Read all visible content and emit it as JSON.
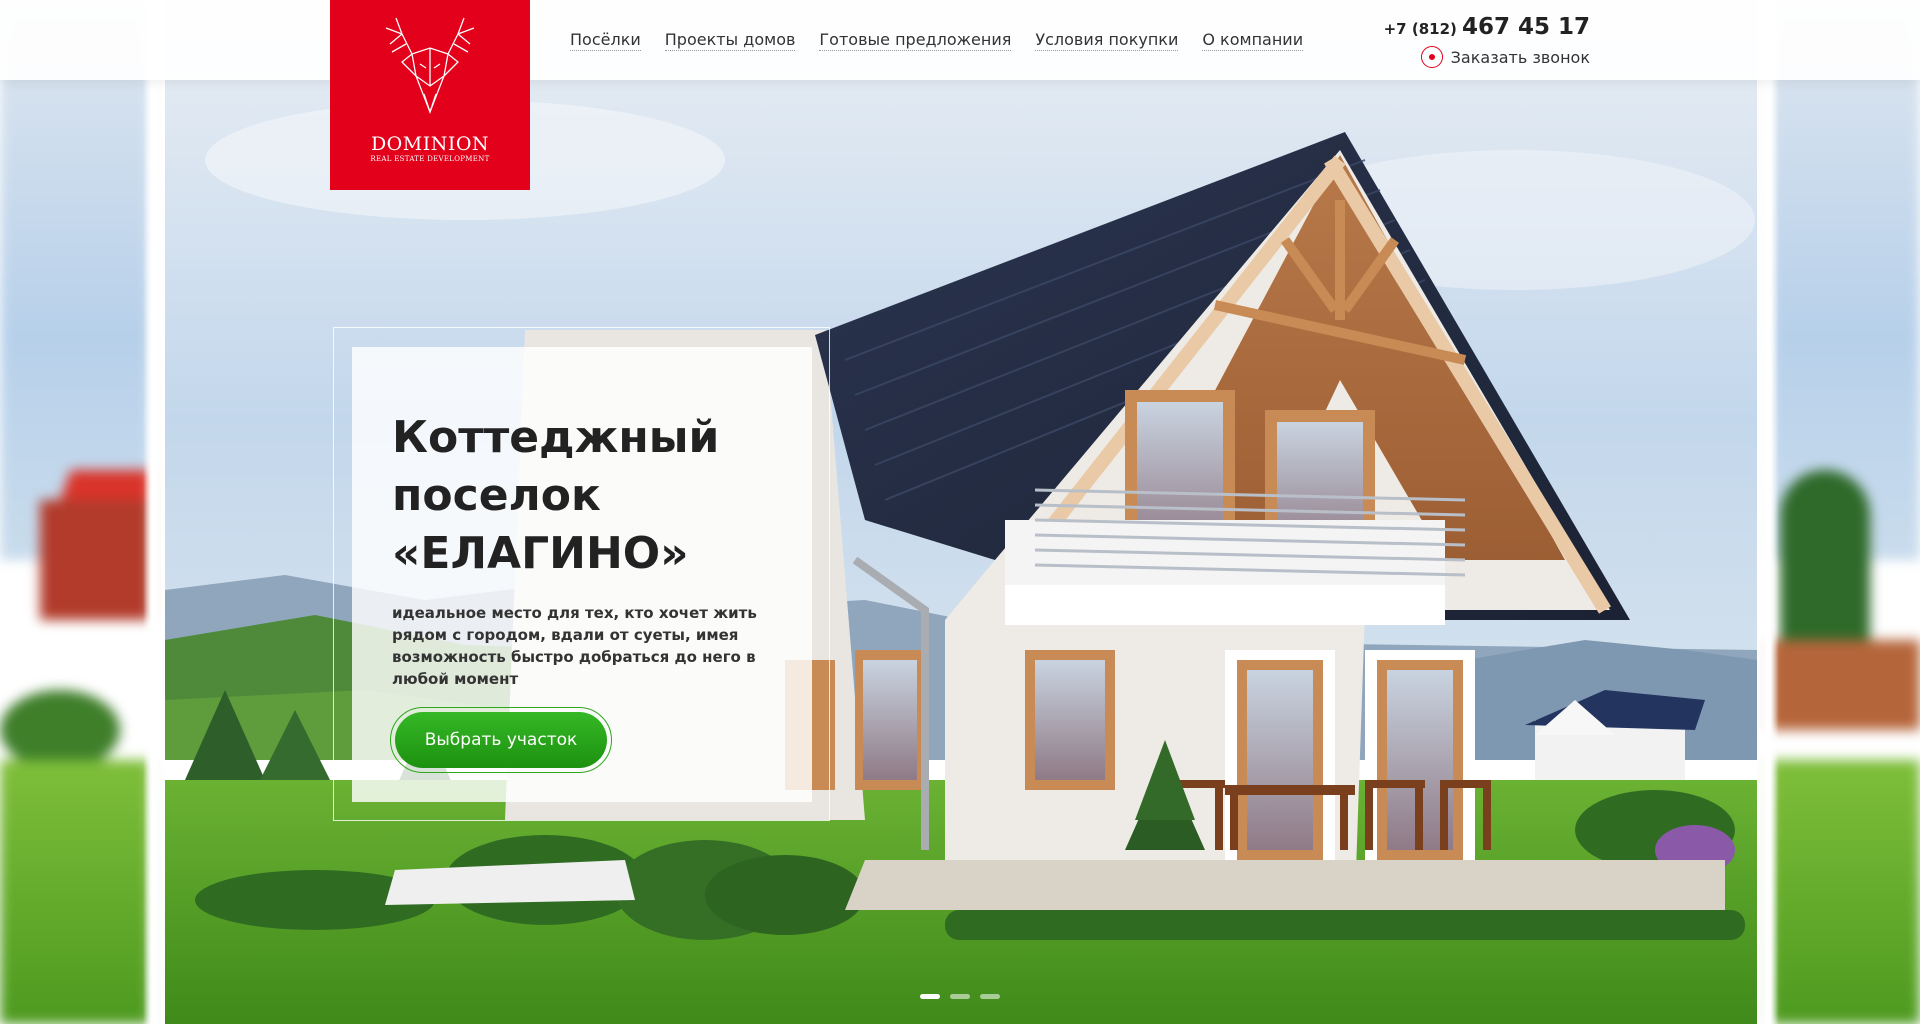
{
  "brand": {
    "name": "DOMINION",
    "tagline": "REAL ESTATE DEVELOPMENT",
    "color": "#e2001a",
    "icon": "deer-head-icon"
  },
  "nav": {
    "items": [
      {
        "label": "Посёлки"
      },
      {
        "label": "Проекты домов"
      },
      {
        "label": "Готовые предложения"
      },
      {
        "label": "Условия покупки"
      },
      {
        "label": "О компании"
      }
    ]
  },
  "contact": {
    "phone_prefix": "+7 (812)",
    "phone_number": "467 45 17",
    "callback_label": "Заказать звонок",
    "callback_icon": "record-dot-icon"
  },
  "hero": {
    "title": "Коттеджный поселок «ЕЛАГИНО»",
    "description": "идеальное место для тех, кто хочет жить рядом с городом, вдали от суеты, имея возможность быстро добраться до него в любой момент",
    "cta_label": "Выбрать участок",
    "cta_color": "#2ea71c"
  },
  "slider": {
    "total_slides": 3,
    "active_slide": 1
  }
}
